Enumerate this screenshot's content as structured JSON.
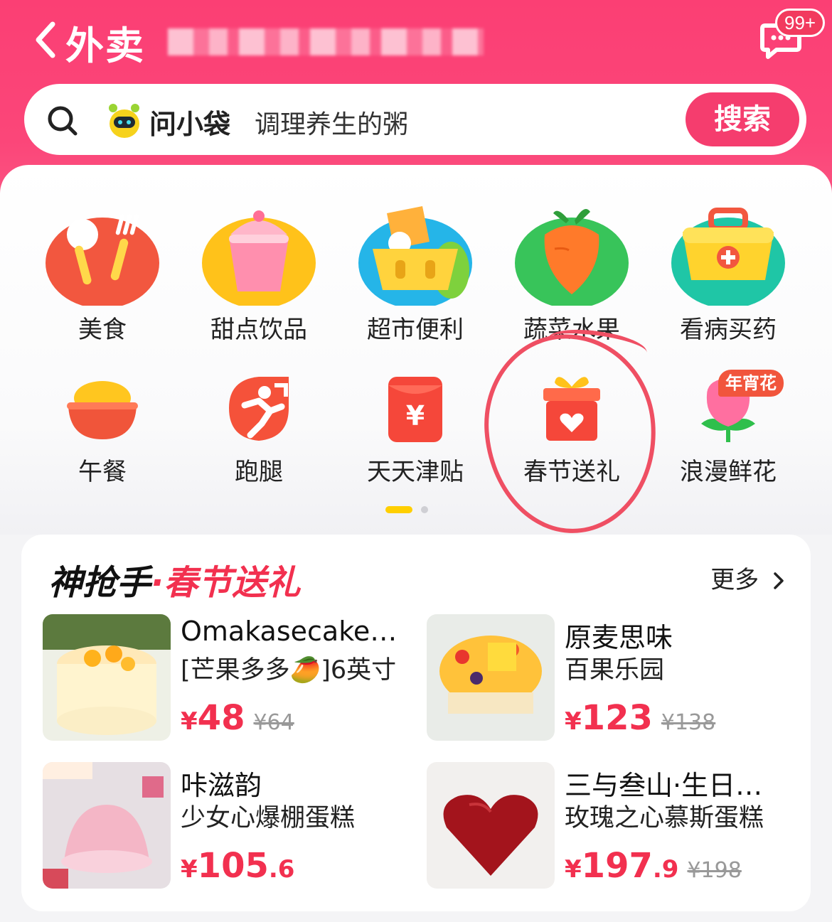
{
  "header": {
    "title": "外卖",
    "badge": "99+"
  },
  "search": {
    "brand": "问小袋",
    "placeholder": "调理养生的粥",
    "button": "搜索"
  },
  "categories": [
    {
      "label": "美食",
      "icon": "fork-spoon-icon"
    },
    {
      "label": "甜点饮品",
      "icon": "ice-cream-cup-icon"
    },
    {
      "label": "超市便利",
      "icon": "shopping-basket-icon"
    },
    {
      "label": "蔬菜水果",
      "icon": "carrot-icon"
    },
    {
      "label": "看病买药",
      "icon": "medical-kit-icon"
    },
    {
      "label": "午餐",
      "icon": "rice-bowl-icon"
    },
    {
      "label": "跑腿",
      "icon": "runner-icon"
    },
    {
      "label": "天天津贴",
      "icon": "red-envelope-icon"
    },
    {
      "label": "春节送礼",
      "icon": "gift-box-icon"
    },
    {
      "label": "浪漫鲜花",
      "icon": "rose-icon",
      "tag": "年宵花"
    }
  ],
  "section": {
    "title_a": "神抢手",
    "separator": "·",
    "title_b": "春节送礼",
    "more": "更多",
    "products": [
      {
        "name": "Omakasecake…",
        "sub": "[芒果多多🥭]6英寸",
        "yen": "¥",
        "price": "48",
        "decimal": "",
        "original": "¥64"
      },
      {
        "name": "原麦思味",
        "sub": "百果乐园",
        "yen": "¥",
        "price": "123",
        "decimal": "",
        "original": "¥138"
      },
      {
        "name": "咔滋韵",
        "sub": "少女心爆棚蛋糕",
        "yen": "¥",
        "price": "105",
        "decimal": ".6",
        "original": ""
      },
      {
        "name": "三与叁山·生日…",
        "sub": "玫瑰之心慕斯蛋糕",
        "yen": "¥",
        "price": "197",
        "decimal": ".9",
        "original": "¥198"
      }
    ]
  },
  "colors": {
    "brand_pink": "#fb4679",
    "price_red": "#f2304f",
    "dot_active": "#ffcf00"
  }
}
